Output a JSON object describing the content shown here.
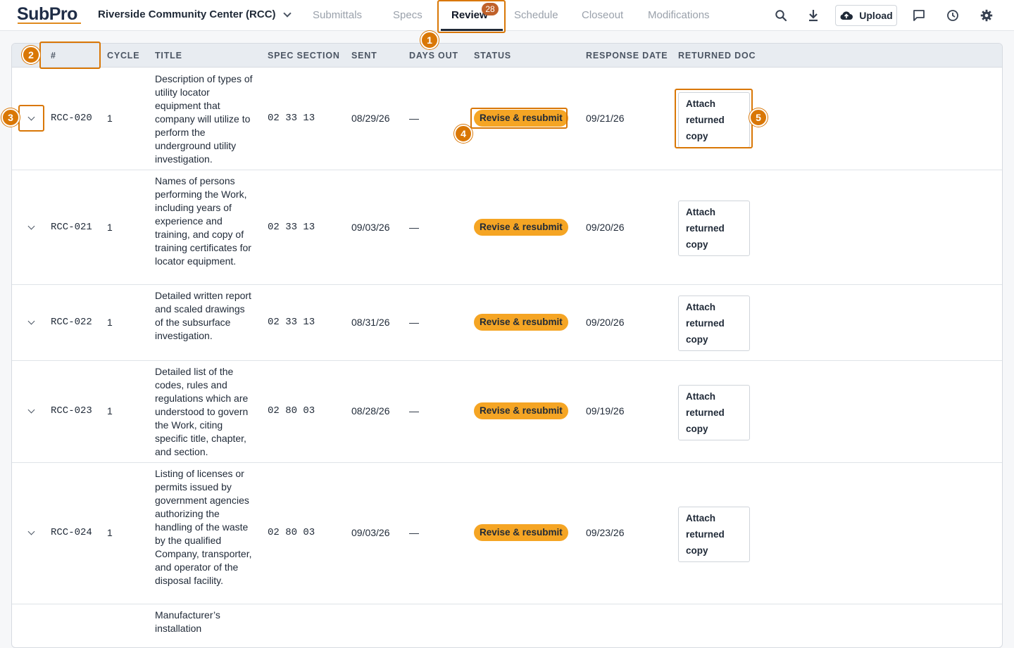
{
  "app": {
    "logo": "SubPro",
    "project": "Riverside Community Center (RCC)"
  },
  "nav": {
    "tabs": [
      {
        "label": "Submittals"
      },
      {
        "label": "Specs"
      },
      {
        "label": "Review",
        "count": "28"
      },
      {
        "label": "Schedule"
      },
      {
        "label": "Closeout"
      },
      {
        "label": "Modifications"
      }
    ],
    "upload_label": "Upload"
  },
  "table": {
    "columns": [
      "#",
      "Cycle",
      "Title",
      "Spec Section",
      "Sent",
      "Days Out",
      "Status",
      "Response Date",
      "Returned Doc"
    ],
    "rows": [
      {
        "id": "RCC-020",
        "cycle": "1",
        "title": "Description of types of utility locator equipment that company will utilize to perform the underground utility investigation.",
        "spec": "02 33 13",
        "sent": "08/29/26",
        "days_out": "—",
        "status": "Revise & resubmit",
        "response": "09/21/26",
        "doc": "Attach returned copy"
      },
      {
        "id": "RCC-021",
        "cycle": "1",
        "title": "Names of persons performing the Work, including years of experience and training, and copy of training certificates for locator equipment.",
        "spec": "02 33 13",
        "sent": "09/03/26",
        "days_out": "—",
        "status": "Revise & resubmit",
        "response": "09/20/26",
        "doc": "Attach returned copy"
      },
      {
        "id": "RCC-022",
        "cycle": "1",
        "title": "Detailed written report and scaled drawings of the subsurface investigation.",
        "spec": "02 33 13",
        "sent": "08/31/26",
        "days_out": "—",
        "status": "Revise & resubmit",
        "response": "09/20/26",
        "doc": "Attach returned copy"
      },
      {
        "id": "RCC-023",
        "cycle": "1",
        "title": "Detailed list of the codes, rules and regulations which are understood to govern the Work, citing specific title, chapter, and section.",
        "spec": "02 80 03",
        "sent": "08/28/26",
        "days_out": "—",
        "status": "Revise & resubmit",
        "response": "09/19/26",
        "doc": "Attach returned copy"
      },
      {
        "id": "RCC-024",
        "cycle": "1",
        "title": "Listing of licenses or permits issued by government agencies authorizing the handling of the waste by the qualified Company, transporter, and operator of the disposal facility.",
        "spec": "02 80 03",
        "sent": "09/03/26",
        "days_out": "—",
        "status": "Revise & resubmit",
        "response": "09/23/26",
        "doc": "Attach returned copy"
      },
      {
        "title": "Manufacturer’s installation"
      }
    ]
  },
  "callouts": [
    "1",
    "2",
    "3",
    "4",
    "5"
  ],
  "colors": {
    "accent": "#d97706",
    "status_pill": "#f5a524",
    "badge": "#c0612a"
  }
}
